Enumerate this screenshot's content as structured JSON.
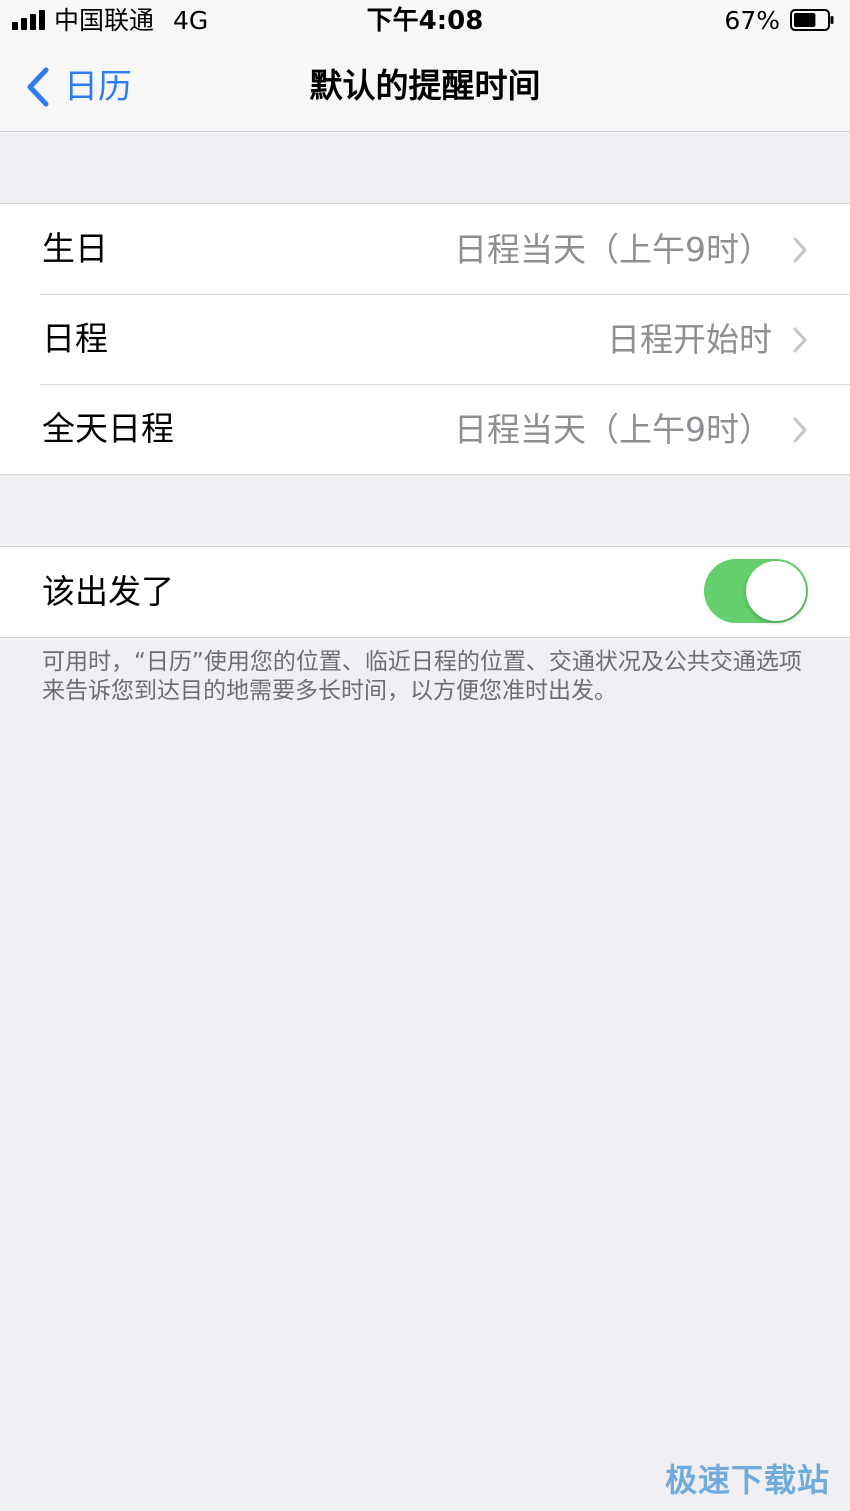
{
  "status_bar": {
    "carrier": "中国联通",
    "network": "4G",
    "time": "下午4:08",
    "battery_percent": "67%",
    "battery_level": 0.67,
    "signal_bars": 4
  },
  "nav": {
    "back_label": "日历",
    "title": "默认的提醒时间"
  },
  "alerts_group": {
    "items": [
      {
        "label": "生日",
        "value": "日程当天（上午9时）"
      },
      {
        "label": "日程",
        "value": "日程开始时"
      },
      {
        "label": "全天日程",
        "value": "日程当天（上午9时）"
      }
    ]
  },
  "leave_group": {
    "label": "该出发了",
    "toggle_on": true,
    "footer": "可用时，“日历”使用您的位置、临近日程的位置、交通状况及公共交通选项来告诉您到达目的地需要多长时间，以方便您准时出发。"
  },
  "watermark": "极速下载站",
  "colors": {
    "accent": "#2f7bf4",
    "toggle_on": "#65d06d",
    "background": "#efeff4",
    "secondary_text": "#8e8e93"
  }
}
